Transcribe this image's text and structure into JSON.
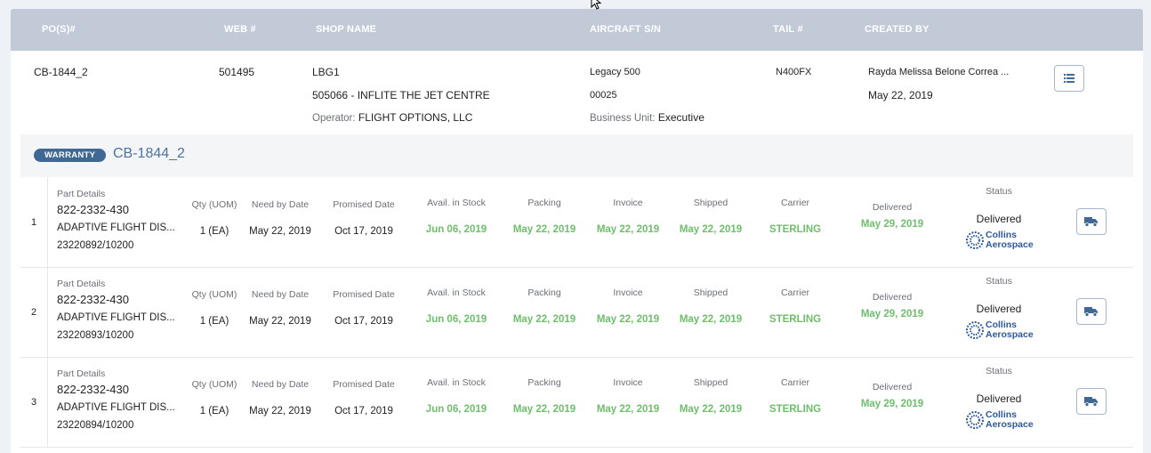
{
  "header": {
    "columns": [
      "PO(S)#",
      "WEB #",
      "SHOP NAME",
      "AIRCRAFT S/N",
      "TAIL #",
      "CREATED BY"
    ]
  },
  "order": {
    "po": "CB-1844_2",
    "web": "501495",
    "shop_code": "LBG1",
    "shop_name": "505066 - INFLITE THE JET CENTRE",
    "operator_label": "Operator:",
    "operator": "FLIGHT OPTIONS, LLC",
    "aircraft": "Legacy 500",
    "serial": "00025",
    "bu_label": "Business Unit:",
    "business_unit": "Executive",
    "tail": "N400FX",
    "created_by": "Rayda Melissa Belone Correa ...",
    "created_date": "May 22, 2019"
  },
  "warranty": {
    "badge": "WARRANTY",
    "title": "CB-1844_2"
  },
  "labels": {
    "part_details": "Part Details",
    "qty": "Qty (UOM)",
    "need_by": "Need by Date",
    "promised": "Promised Date",
    "stock": "Avail. in Stock",
    "packing": "Packing",
    "invoice": "Invoice",
    "shipped": "Shipped",
    "carrier": "Carrier",
    "delivered": "Delivered",
    "status": "Status"
  },
  "logo": {
    "line1": "Collins",
    "line2": "Aerospace"
  },
  "lines": [
    {
      "num": "1",
      "part_number": "822-2332-430",
      "description": "ADAPTIVE FLIGHT DIS...",
      "ref": "23220892/10200",
      "qty": "1 (EA)",
      "need_by": "May 22, 2019",
      "promised": "Oct 17, 2019",
      "stock": "Jun 06, 2019",
      "packing": "May 22, 2019",
      "invoice": "May 22, 2019",
      "shipped": "May 22, 2019",
      "carrier": "STERLING",
      "delivered": "May 29, 2019",
      "status": "Delivered"
    },
    {
      "num": "2",
      "part_number": "822-2332-430",
      "description": "ADAPTIVE FLIGHT DIS...",
      "ref": "23220893/10200",
      "qty": "1 (EA)",
      "need_by": "May 22, 2019",
      "promised": "Oct 17, 2019",
      "stock": "Jun 06, 2019",
      "packing": "May 22, 2019",
      "invoice": "May 22, 2019",
      "shipped": "May 22, 2019",
      "carrier": "STERLING",
      "delivered": "May 29, 2019",
      "status": "Delivered"
    },
    {
      "num": "3",
      "part_number": "822-2332-430",
      "description": "ADAPTIVE FLIGHT DIS...",
      "ref": "23220894/10200",
      "qty": "1 (EA)",
      "need_by": "May 22, 2019",
      "promised": "Oct 17, 2019",
      "stock": "Jun 06, 2019",
      "packing": "May 22, 2019",
      "invoice": "May 22, 2019",
      "shipped": "May 22, 2019",
      "carrier": "STERLING",
      "delivered": "May 29, 2019",
      "status": "Delivered"
    }
  ],
  "icons": {
    "details": "list-icon",
    "tracking": "truck-icon"
  },
  "colors": {
    "header_bg": "#c2cad8",
    "accent": "#3f6895",
    "date_green": "#6dbf6a"
  }
}
